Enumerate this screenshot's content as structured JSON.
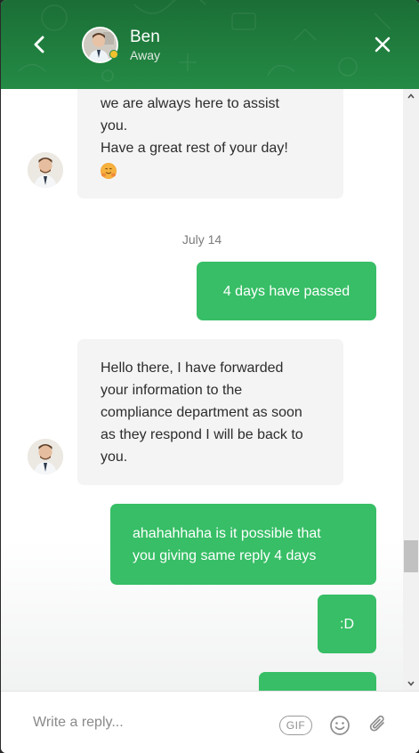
{
  "header": {
    "agent_name": "Ben",
    "agent_status": "Away",
    "accent_color": "#248b45",
    "status_color": "#f2c12e",
    "back_icon": "chevron-left-icon",
    "close_icon": "close-icon"
  },
  "messages": [
    {
      "sender": "agent",
      "lines": [
        "we are always here to assist",
        "you.",
        "Have a great rest of your day!"
      ],
      "emoji": "hugging-face-emoji"
    },
    {
      "type": "date",
      "text": "July 14"
    },
    {
      "sender": "user",
      "text": "4 days have passed"
    },
    {
      "sender": "agent",
      "lines": [
        "Hello there, I have forwarded",
        "your information to the",
        "compliance department as soon",
        "as they respond I will be back to",
        "you."
      ]
    },
    {
      "sender": "user",
      "lines": [
        "ahahahhaha is it possible that",
        "you giving same reply 4 days"
      ]
    },
    {
      "sender": "user",
      "text": ":D"
    },
    {
      "sender": "user",
      "text": ""
    }
  ],
  "composer": {
    "placeholder": "Write a reply...",
    "gif_label": "GIF",
    "emoji_icon": "smiley-icon",
    "attach_icon": "paperclip-icon"
  },
  "colors": {
    "user_bubble": "#37be66",
    "agent_bubble": "#f4f4f4"
  }
}
